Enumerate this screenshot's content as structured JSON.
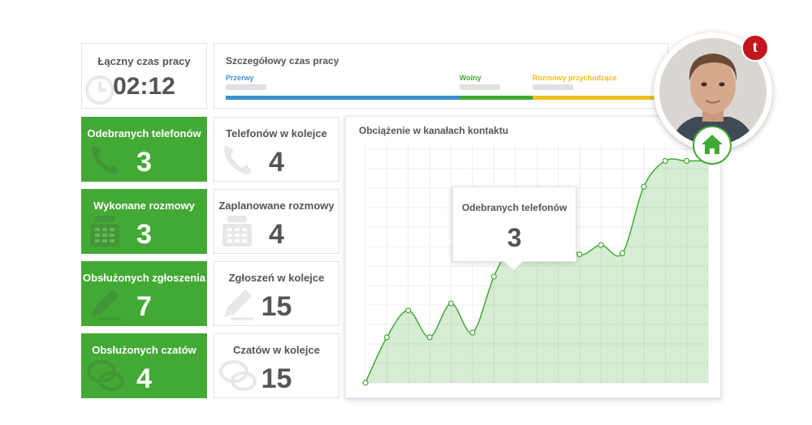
{
  "total_time": {
    "title": "Łączny czas pracy",
    "value": "02:12"
  },
  "detailed_time": {
    "title": "Szczegółowy czas pracy",
    "segments": [
      {
        "label": "Przerwy",
        "color": "#3b8fd0",
        "fraction": 0.545
      },
      {
        "label": "Wolny",
        "color": "#43a935",
        "fraction": 0.17
      },
      {
        "label": "Rozmowy przychodzące",
        "color": "#f0bd1c",
        "fraction": 0.285
      }
    ]
  },
  "tiles": [
    {
      "title": "Odebranych telefonów",
      "value": "3",
      "icon": "phone-icon",
      "accent": true
    },
    {
      "title": "Telefonów w kolejce",
      "value": "4",
      "icon": "phone-icon",
      "accent": false
    },
    {
      "title": "Wykonane rozmowy",
      "value": "3",
      "icon": "keypad-phone-icon",
      "accent": true
    },
    {
      "title": "Zaplanowane rozmowy",
      "value": "4",
      "icon": "keypad-phone-icon",
      "accent": false
    },
    {
      "title": "Obsłużonych zgłoszenia",
      "value": "7",
      "icon": "pencil-icon",
      "accent": true
    },
    {
      "title": "Zgłoszeń w kolejce",
      "value": "15",
      "icon": "pencil-icon",
      "accent": false
    },
    {
      "title": "Obsłużonych czatów",
      "value": "4",
      "icon": "chat-bubbles-icon",
      "accent": true
    },
    {
      "title": "Czatów w kolejce",
      "value": "15",
      "icon": "chat-bubbles-icon",
      "accent": false
    }
  ],
  "chart": {
    "title": "Obciążenie w kanałach kontaktu",
    "tooltip": {
      "title": "Odebranych telefonów",
      "value": "3"
    }
  },
  "chart_data": {
    "type": "area",
    "x": [
      0,
      1,
      2,
      3,
      4,
      5,
      6,
      7,
      8,
      9,
      10,
      11,
      12,
      13,
      14,
      15,
      16
    ],
    "values": [
      0,
      19.5,
      31,
      19.5,
      34,
      21.5,
      45.5,
      62.5,
      71,
      66,
      55,
      59,
      55.5,
      84,
      95,
      95,
      95
    ],
    "ylim": [
      0,
      100
    ],
    "xlim": [
      0,
      16
    ],
    "grid": true,
    "color": "#43a935"
  },
  "badges": {
    "logo": "t"
  },
  "colors": {
    "accent_green": "#43a935",
    "logo_red": "#c4161c"
  }
}
